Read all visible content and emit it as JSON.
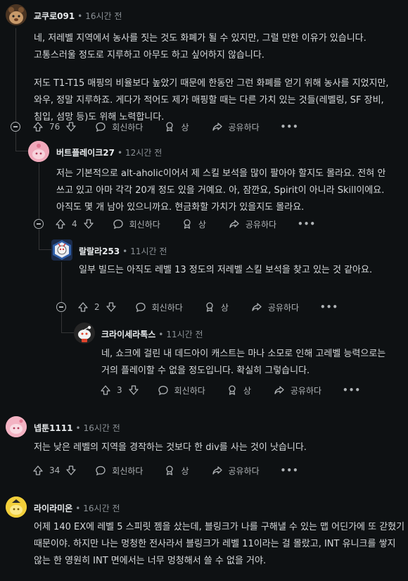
{
  "comments": [
    {
      "author": "교쿠로091",
      "time": "16시간 전",
      "paragraphs": [
        "네, 저레벨 지역에서 농사를 짓는 것도 화폐가 될 수 있지만, 그럴 만한 이유가 있습니다. 고통스러울 정도로 지루하고 아무도 하고 싶어하지 않습니다.",
        "저도 T1-T15 매핑의 비율보다 높았기 때문에 한동안 그런 화폐를 얻기 위해 농사를 지었지만, 와우, 정말 지루하죠. 게다가 적어도 제가 매핑할 때는 다른 가치 있는 것들(레벨링, SF 장비, 침입, 섬망 등)도 위해 노력합니다."
      ],
      "votes": "76"
    },
    {
      "author": "버트플레이크27",
      "time": "12시간 전",
      "paragraphs": [
        "저는 기본적으로 alt-aholic이어서 제 스킬 보석을 많이 팔아야 할지도 몰라요. 전혀 안 쓰고 있고 아마 각각 20개 정도 있을 거예요. 아, 잠깐요, Spirit이 아니라 Skill이에요. 아직도 몇 개 남아 있으니까요. 현금화할 가치가 있을지도 몰라요."
      ],
      "votes": "4"
    },
    {
      "author": "랄랄라253",
      "time": "11시간 전",
      "paragraphs": [
        "일부 빌드는 아직도 레벨 13 정도의 저레벨 스킬 보석을 찾고 있는 것 같아요."
      ],
      "votes": "2"
    },
    {
      "author": "크라이세라톡스",
      "time": "11시간 전",
      "paragraphs": [
        "네, 쇼크에 걸린 내 데드아이 캐스트는 마나 소모로 인해 고레벨 능력으로는 거의 플레이할 수 없을 정도입니다. 확실히 그렇습니다."
      ],
      "votes": "3"
    },
    {
      "author": "넵툰1111",
      "time": "16시간 전",
      "paragraphs": [
        "저는 낮은 레벨의 지역을 경작하는 것보다 한 div를 사는 것이 낫습니다."
      ],
      "votes": "34"
    },
    {
      "author": "라이라미온",
      "time": "16시간 전",
      "paragraphs": [
        "어제 140 EX에 레벨 5 스피릿 젬을 샀는데, 블링크가 나를 구해낼 수 있는 맵 어딘가에 또 갇혔기 때문이야. 하지만 나는 멍청한 전사라서 블링크가 레벨 11이라는 걸 몰랐고, INT 유니크를 쌓지 않는 한 영원히 INT 면에서는 너무 멍청해서 쓸 수 없을 거야."
      ]
    }
  ],
  "labels": {
    "reply": "회신하다",
    "award": "상",
    "share": "공유하다",
    "more": "•••"
  },
  "icons": [
    "upvote-icon",
    "downvote-icon",
    "comment-icon",
    "award-icon",
    "share-icon",
    "more-icon",
    "collapse-icon"
  ]
}
